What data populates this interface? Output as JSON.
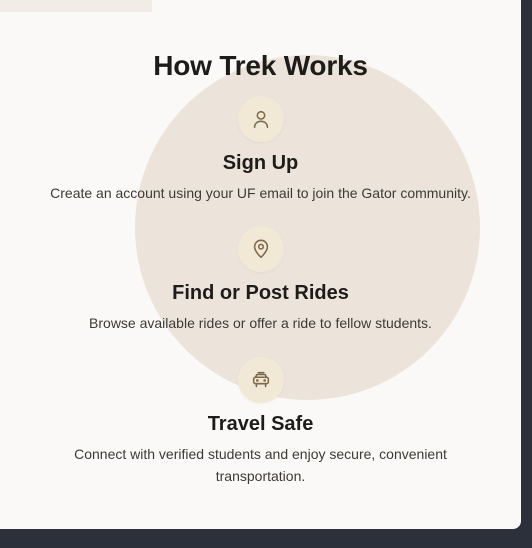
{
  "section": {
    "title": "How Trek Works"
  },
  "steps": [
    {
      "icon": "user-icon",
      "title": "Sign Up",
      "description": "Create an account using your UF email to join the Gator community."
    },
    {
      "icon": "map-pin-icon",
      "title": "Find or Post Rides",
      "description": "Browse available rides or offer a ride to fellow students."
    },
    {
      "icon": "car-icon",
      "title": "Travel Safe",
      "description": "Connect with verified students and enjoy secure, convenient transportation."
    }
  ],
  "colors": {
    "panel_background": "#fbf9f7",
    "page_background": "#2c303a",
    "accent_circle": "#ece4da",
    "icon_background": "#f1e8d6",
    "icon_stroke": "#7d6a4d"
  }
}
